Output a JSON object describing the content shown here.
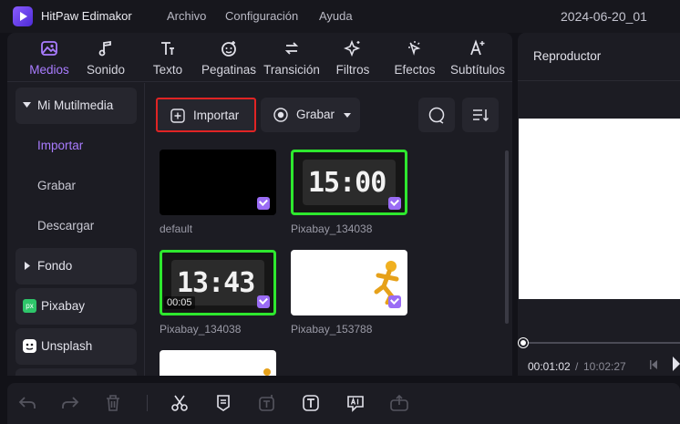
{
  "app": {
    "title": "HitPaw Edimakor",
    "project_name": "2024-06-20_01"
  },
  "menu": {
    "items": [
      "Archivo",
      "Configuración",
      "Ayuda"
    ]
  },
  "toolbar": {
    "tabs": [
      {
        "label": "Medios",
        "icon": "image-icon",
        "active": true
      },
      {
        "label": "Sonido",
        "icon": "music-note-icon"
      },
      {
        "label": "Texto",
        "icon": "text-icon"
      },
      {
        "label": "Pegatinas",
        "icon": "sticker-icon"
      },
      {
        "label": "Transición",
        "icon": "transition-icon"
      },
      {
        "label": "Filtros",
        "icon": "filter-icon"
      },
      {
        "label": "Efectos",
        "icon": "effects-icon"
      },
      {
        "label": "Subtítulos",
        "icon": "subtitles-icon"
      }
    ]
  },
  "sidebar": {
    "my_media": "Mi Mutilmedia",
    "import": "Importar",
    "record": "Grabar",
    "download": "Descargar",
    "background": "Fondo",
    "pixabay": "Pixabay",
    "pixabay_badge": "px",
    "unsplash": "Unsplash"
  },
  "content": {
    "import_label": "Importar",
    "record_label": "Grabar",
    "media": [
      {
        "name": "default"
      },
      {
        "name": "Pixabay_134038",
        "clock": "15:00"
      },
      {
        "name": "Pixabay_134038",
        "clock": "13:43",
        "duration": "00:05"
      },
      {
        "name": "Pixabay_153788"
      }
    ]
  },
  "player": {
    "title": "Reproductor",
    "current_time": "00:01:02",
    "separator": "/",
    "total_time": "10:02:27"
  },
  "colors": {
    "accent": "#a97cff",
    "selection": "#2ee82e",
    "highlight": "#e02424"
  }
}
